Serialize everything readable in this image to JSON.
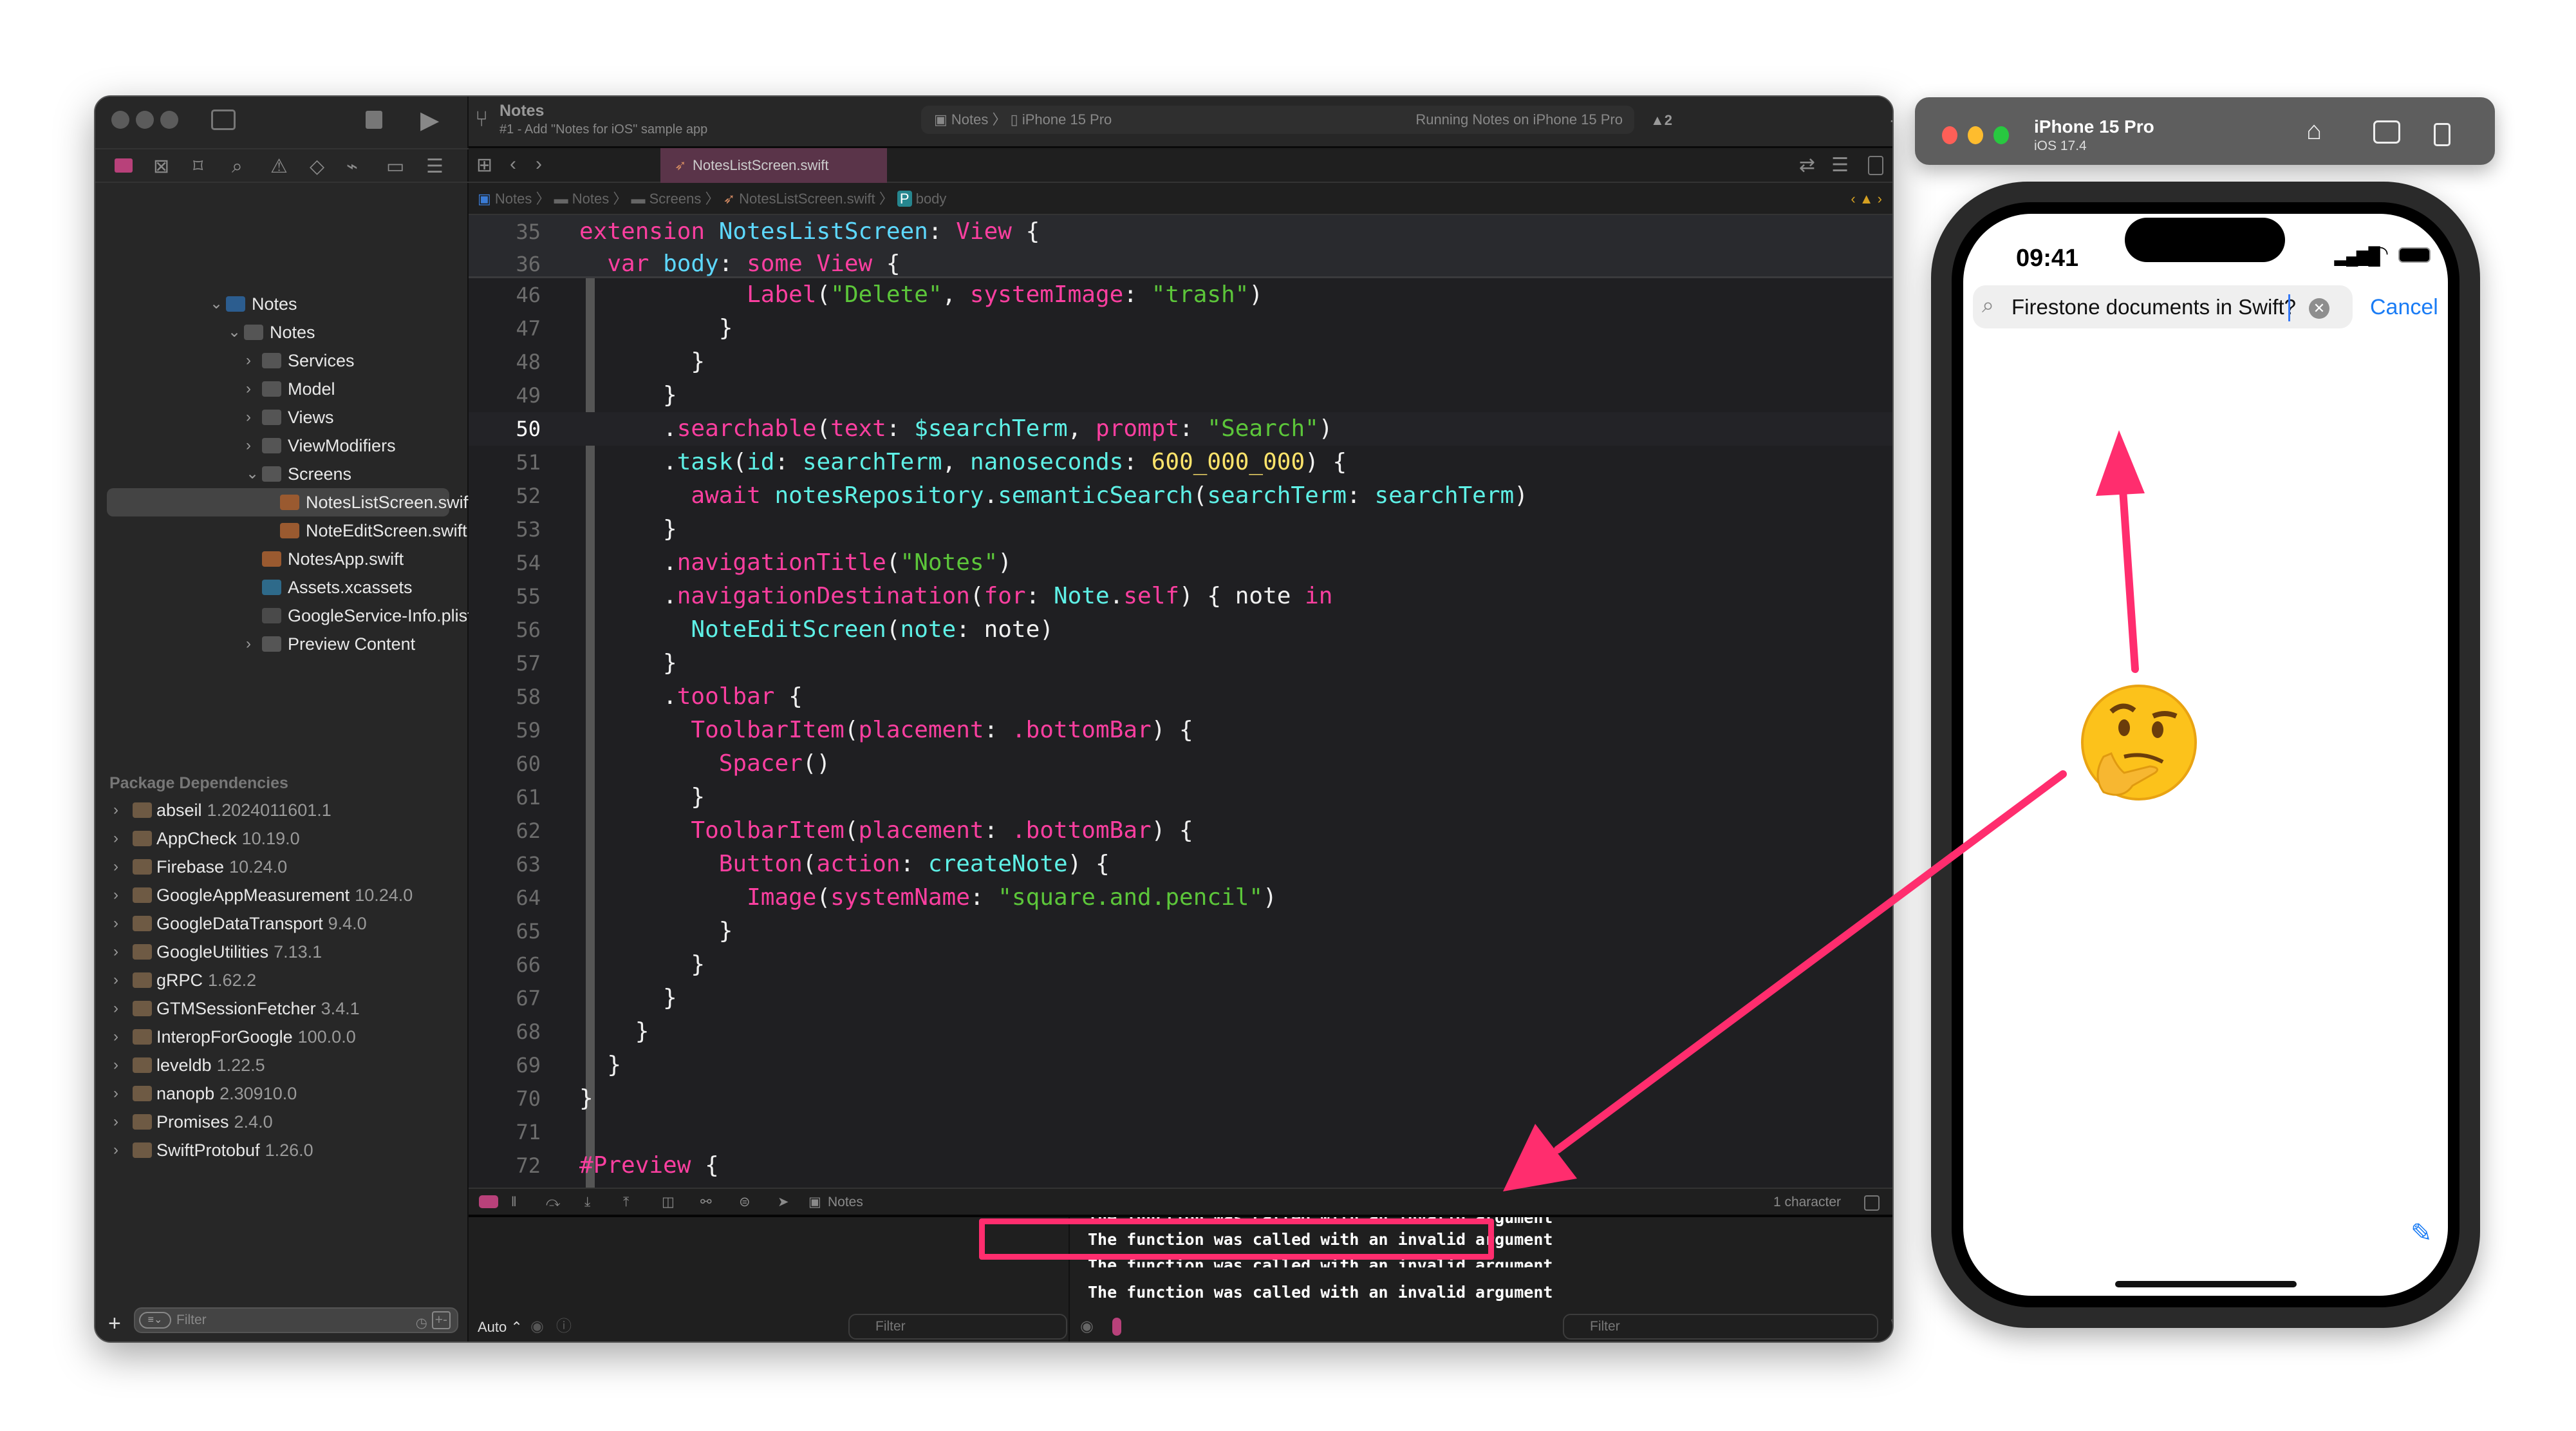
{
  "xcode": {
    "project_title": "Notes",
    "commit_subtitle": "#1 - Add \"Notes for iOS\" sample app",
    "scheme": "Notes",
    "destination": "iPhone 15 Pro",
    "status": "Running Notes on iPhone 15 Pro",
    "warning_count": "2",
    "open_tab": "NotesListScreen.swift",
    "breadcrumb": [
      "Notes",
      "Notes",
      "Screens",
      "NotesListScreen.swift",
      "body"
    ],
    "navigator": {
      "tree": [
        {
          "label": "Notes",
          "level": 0,
          "icon": "app-project-icon",
          "expanded": true
        },
        {
          "label": "Notes",
          "level": 1,
          "icon": "folder-icon",
          "expanded": true
        },
        {
          "label": "Services",
          "level": 2,
          "icon": "folder-icon",
          "expanded": false
        },
        {
          "label": "Model",
          "level": 2,
          "icon": "folder-icon",
          "expanded": false
        },
        {
          "label": "Views",
          "level": 2,
          "icon": "folder-icon",
          "expanded": false
        },
        {
          "label": "ViewModifiers",
          "level": 2,
          "icon": "folder-icon",
          "expanded": false
        },
        {
          "label": "Screens",
          "level": 2,
          "icon": "folder-icon",
          "expanded": true
        },
        {
          "label": "NotesListScreen.swift",
          "level": 3,
          "icon": "swift-file-icon",
          "selected": true
        },
        {
          "label": "NoteEditScreen.swift",
          "level": 3,
          "icon": "swift-file-icon"
        },
        {
          "label": "NotesApp.swift",
          "level": 2,
          "icon": "swift-file-icon"
        },
        {
          "label": "Assets.xcassets",
          "level": 2,
          "icon": "asset-catalog-icon"
        },
        {
          "label": "GoogleService-Info.plist",
          "level": 2,
          "icon": "plist-icon"
        },
        {
          "label": "Preview Content",
          "level": 2,
          "icon": "folder-icon",
          "expanded": false
        }
      ],
      "packages_header": "Package Dependencies",
      "packages": [
        {
          "name": "abseil",
          "version": "1.2024011601.1"
        },
        {
          "name": "AppCheck",
          "version": "10.19.0"
        },
        {
          "name": "Firebase",
          "version": "10.24.0"
        },
        {
          "name": "GoogleAppMeasurement",
          "version": "10.24.0"
        },
        {
          "name": "GoogleDataTransport",
          "version": "9.4.0"
        },
        {
          "name": "GoogleUtilities",
          "version": "7.13.1"
        },
        {
          "name": "gRPC",
          "version": "1.62.2"
        },
        {
          "name": "GTMSessionFetcher",
          "version": "3.4.1"
        },
        {
          "name": "InteropForGoogle",
          "version": "100.0.0"
        },
        {
          "name": "leveldb",
          "version": "1.22.5"
        },
        {
          "name": "nanopb",
          "version": "2.30910.0"
        },
        {
          "name": "Promises",
          "version": "2.4.0"
        },
        {
          "name": "SwiftProtobuf",
          "version": "1.26.0"
        }
      ],
      "filter_placeholder": "Filter"
    },
    "sticky_lines": [
      {
        "n": "35",
        "tokens": [
          [
            "k",
            "extension "
          ],
          [
            "t",
            "NotesListScreen"
          ],
          [
            "p",
            ": "
          ],
          [
            "k",
            "View"
          ],
          [
            "p",
            " {"
          ]
        ]
      },
      {
        "n": "36",
        "tokens": [
          [
            "p",
            "  "
          ],
          [
            "k",
            "var "
          ],
          [
            "t",
            "body"
          ],
          [
            "p",
            ": "
          ],
          [
            "k",
            "some "
          ],
          [
            "k",
            "View"
          ],
          [
            "p",
            " {"
          ]
        ]
      }
    ],
    "code_lines": [
      {
        "n": "46",
        "tokens": [
          [
            "p",
            "            "
          ],
          [
            "k",
            "Label"
          ],
          [
            "p",
            "("
          ],
          [
            "s",
            "\"Delete\""
          ],
          [
            "p",
            ", "
          ],
          [
            "k",
            "systemImage"
          ],
          [
            "p",
            ": "
          ],
          [
            "s",
            "\"trash\""
          ],
          [
            "p",
            ")"
          ]
        ]
      },
      {
        "n": "47",
        "tokens": [
          [
            "p",
            "          }"
          ]
        ]
      },
      {
        "n": "48",
        "tokens": [
          [
            "p",
            "        }"
          ]
        ]
      },
      {
        "n": "49",
        "tokens": [
          [
            "p",
            "      }"
          ]
        ]
      },
      {
        "n": "50",
        "current": true,
        "tokens": [
          [
            "p",
            "      ."
          ],
          [
            "k",
            "searchable"
          ],
          [
            "p",
            "("
          ],
          [
            "k",
            "text"
          ],
          [
            "p",
            ": "
          ],
          [
            "f",
            "$searchTerm"
          ],
          [
            "p",
            ", "
          ],
          [
            "k",
            "prompt"
          ],
          [
            "p",
            ": "
          ],
          [
            "s",
            "\"Search\""
          ],
          [
            "p",
            ")"
          ]
        ]
      },
      {
        "n": "51",
        "tokens": [
          [
            "p",
            "      ."
          ],
          [
            "f",
            "task"
          ],
          [
            "p",
            "("
          ],
          [
            "f",
            "id"
          ],
          [
            "p",
            ": "
          ],
          [
            "f",
            "searchTerm"
          ],
          [
            "p",
            ", "
          ],
          [
            "f",
            "nanoseconds"
          ],
          [
            "p",
            ": "
          ],
          [
            "n",
            "600_000_000"
          ],
          [
            "p",
            ") {"
          ]
        ]
      },
      {
        "n": "52",
        "tokens": [
          [
            "p",
            "        "
          ],
          [
            "k",
            "await "
          ],
          [
            "f",
            "notesRepository"
          ],
          [
            "p",
            "."
          ],
          [
            "f",
            "semanticSearch"
          ],
          [
            "p",
            "("
          ],
          [
            "f",
            "searchTerm"
          ],
          [
            "p",
            ": "
          ],
          [
            "f",
            "searchTerm"
          ],
          [
            "p",
            ")"
          ]
        ]
      },
      {
        "n": "53",
        "tokens": [
          [
            "p",
            "      }"
          ]
        ]
      },
      {
        "n": "54",
        "tokens": [
          [
            "p",
            "      ."
          ],
          [
            "k",
            "navigationTitle"
          ],
          [
            "p",
            "("
          ],
          [
            "s",
            "\"Notes\""
          ],
          [
            "p",
            ")"
          ]
        ]
      },
      {
        "n": "55",
        "tokens": [
          [
            "p",
            "      ."
          ],
          [
            "k",
            "navigationDestination"
          ],
          [
            "p",
            "("
          ],
          [
            "k",
            "for"
          ],
          [
            "p",
            ": "
          ],
          [
            "f",
            "Note"
          ],
          [
            "p",
            "."
          ],
          [
            "k",
            "self"
          ],
          [
            "p",
            ") { note "
          ],
          [
            "k",
            "in"
          ]
        ]
      },
      {
        "n": "56",
        "tokens": [
          [
            "p",
            "        "
          ],
          [
            "f",
            "NoteEditScreen"
          ],
          [
            "p",
            "("
          ],
          [
            "f",
            "note"
          ],
          [
            "p",
            ": note)"
          ]
        ]
      },
      {
        "n": "57",
        "tokens": [
          [
            "p",
            "      }"
          ]
        ]
      },
      {
        "n": "58",
        "tokens": [
          [
            "p",
            "      ."
          ],
          [
            "k",
            "toolbar"
          ],
          [
            "p",
            " {"
          ]
        ]
      },
      {
        "n": "59",
        "tokens": [
          [
            "p",
            "        "
          ],
          [
            "k",
            "ToolbarItem"
          ],
          [
            "p",
            "("
          ],
          [
            "k",
            "placement"
          ],
          [
            "p",
            ": "
          ],
          [
            "k",
            ".bottomBar"
          ],
          [
            "p",
            ") {"
          ]
        ]
      },
      {
        "n": "60",
        "tokens": [
          [
            "p",
            "          "
          ],
          [
            "k",
            "Spacer"
          ],
          [
            "p",
            "()"
          ]
        ]
      },
      {
        "n": "61",
        "tokens": [
          [
            "p",
            "        }"
          ]
        ]
      },
      {
        "n": "62",
        "tokens": [
          [
            "p",
            "        "
          ],
          [
            "k",
            "ToolbarItem"
          ],
          [
            "p",
            "("
          ],
          [
            "k",
            "placement"
          ],
          [
            "p",
            ": "
          ],
          [
            "k",
            ".bottomBar"
          ],
          [
            "p",
            ") {"
          ]
        ]
      },
      {
        "n": "63",
        "tokens": [
          [
            "p",
            "          "
          ],
          [
            "k",
            "Button"
          ],
          [
            "p",
            "("
          ],
          [
            "k",
            "action"
          ],
          [
            "p",
            ": "
          ],
          [
            "f",
            "createNote"
          ],
          [
            "p",
            ") {"
          ]
        ]
      },
      {
        "n": "64",
        "tokens": [
          [
            "p",
            "            "
          ],
          [
            "k",
            "Image"
          ],
          [
            "p",
            "("
          ],
          [
            "k",
            "systemName"
          ],
          [
            "p",
            ": "
          ],
          [
            "s",
            "\"square.and.pencil\""
          ],
          [
            "p",
            ")"
          ]
        ]
      },
      {
        "n": "65",
        "tokens": [
          [
            "p",
            "          }"
          ]
        ]
      },
      {
        "n": "66",
        "tokens": [
          [
            "p",
            "        }"
          ]
        ]
      },
      {
        "n": "67",
        "tokens": [
          [
            "p",
            "      }"
          ]
        ]
      },
      {
        "n": "68",
        "tokens": [
          [
            "p",
            "    }"
          ]
        ]
      },
      {
        "n": "69",
        "tokens": [
          [
            "p",
            "  }"
          ]
        ]
      },
      {
        "n": "70",
        "tokens": [
          [
            "p",
            "}"
          ]
        ]
      },
      {
        "n": "71",
        "tokens": []
      },
      {
        "n": "72",
        "tokens": [
          [
            "k",
            "#Preview"
          ],
          [
            "p",
            " {"
          ]
        ]
      }
    ],
    "debug_bar": {
      "target": "Notes",
      "selection": "1 character"
    },
    "variables": {
      "mode": "Auto",
      "filter_placeholder": "Filter"
    },
    "console": {
      "lines": [
        "The function was called with an invalid argument",
        "The function was called with an invalid argument",
        "The function was called with an invalid argument",
        "The function was called with an invalid argument"
      ],
      "filter_placeholder": "Filter"
    }
  },
  "simulator": {
    "device": "iPhone 15 Pro",
    "os": "iOS 17.4",
    "time": "09:41",
    "search_text": "Firestone documents in Swift?",
    "cancel_label": "Cancel"
  },
  "annotation": {
    "color": "#ff2d6e",
    "highlight_color": "#ff2d6e"
  }
}
